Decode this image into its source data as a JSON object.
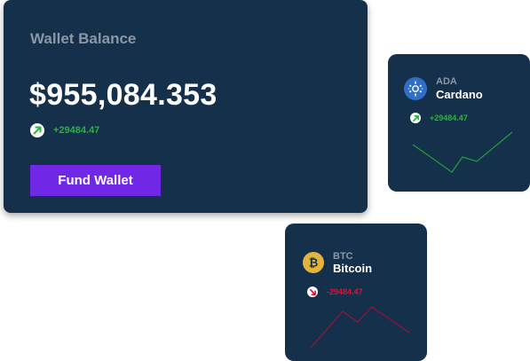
{
  "wallet": {
    "title": "Wallet Balance",
    "balance": "$955,084.353",
    "change": "+29484.47",
    "fund_button": "Fund Wallet"
  },
  "coins": [
    {
      "symbol": "ADA",
      "name": "Cardano",
      "change": "+29484.47",
      "trend": "up",
      "icon": "cardano-icon",
      "line_color": "#1f9e3a"
    },
    {
      "symbol": "BTC",
      "name": "Bitcoin",
      "change": "-29484.47",
      "trend": "down",
      "icon": "bitcoin-icon",
      "line_color": "#9c1037"
    }
  ],
  "colors": {
    "card_bg": "#14304a",
    "accent": "#7127e6",
    "up": "#27b53e",
    "down": "#e0103a"
  }
}
